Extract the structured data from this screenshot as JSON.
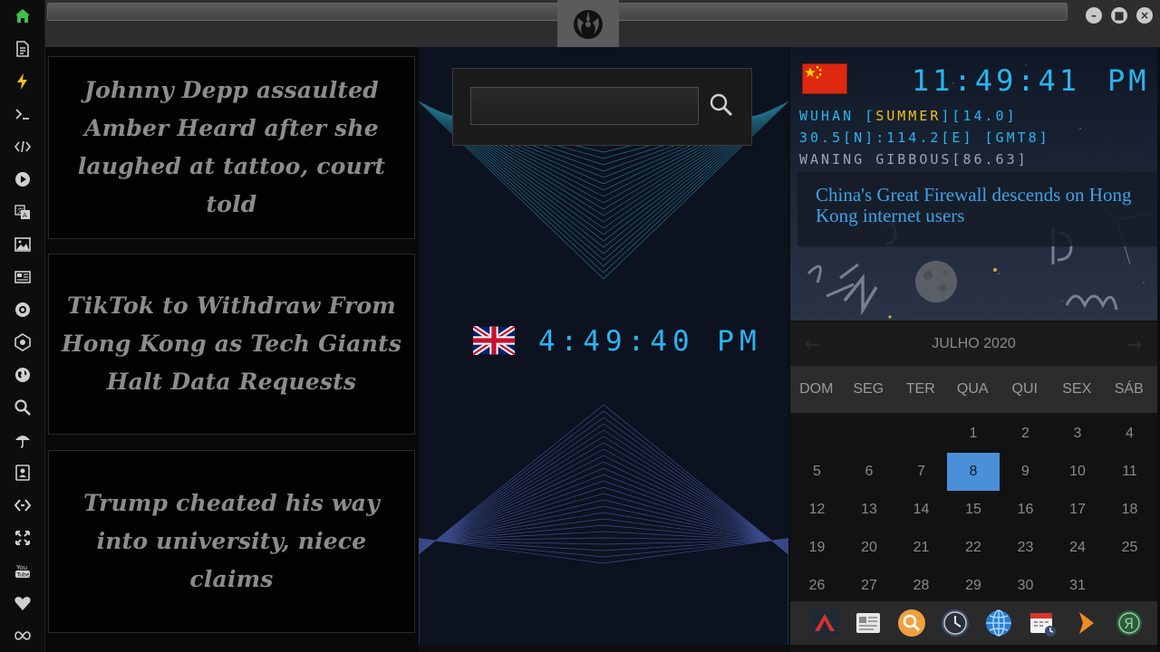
{
  "sidebar": {
    "items": [
      {
        "icon": "home-icon"
      },
      {
        "icon": "document-icon"
      },
      {
        "icon": "lightning-icon"
      },
      {
        "icon": "terminal-icon"
      },
      {
        "icon": "code-icon"
      },
      {
        "icon": "play-icon"
      },
      {
        "icon": "translate-icon"
      },
      {
        "icon": "image-icon"
      },
      {
        "icon": "newspaper-icon"
      },
      {
        "icon": "rebel-alliance-icon"
      },
      {
        "icon": "empire-icon"
      },
      {
        "icon": "globe-icon"
      },
      {
        "icon": "search-icon"
      },
      {
        "icon": "umbrella-icon"
      },
      {
        "icon": "contacts-icon"
      },
      {
        "icon": "dev-icon"
      },
      {
        "icon": "expand-icon"
      },
      {
        "icon": "youtube-icon"
      },
      {
        "icon": "heart-icon"
      },
      {
        "icon": "infinity-icon"
      }
    ],
    "active_color": "#3cc24a",
    "accent_color": "#f0c020",
    "youtube_label": "You Tube"
  },
  "titlebar": {
    "logo_icon": "rebel-alliance-logo",
    "buttons": {
      "minimize": "–",
      "maximize": "■",
      "close": "×"
    }
  },
  "news": {
    "articles": [
      {
        "headline": "Johnny Depp assaulted Amber Heard after she laughed at tattoo, court told"
      },
      {
        "headline": "TikTok to Withdraw From Hong Kong as Tech Giants Halt Data Requests"
      },
      {
        "headline": "Trump cheated his way into university, niece claims"
      }
    ]
  },
  "center": {
    "search": {
      "value": "",
      "placeholder": ""
    },
    "uk_clock": {
      "flag": "uk-flag",
      "time": "4:49:40 PM"
    }
  },
  "china_panel": {
    "flag": "china-flag",
    "time": "11:49:41",
    "ampm": "PM",
    "location_prefix": "WUHAN [",
    "season": "SUMMER",
    "location_suffix": "][14.0]",
    "coords": "30.5[N]:114.2[E] [GMT8]",
    "moon": "WANING GIBBOUS[86.63]",
    "headline": "China's Great Firewall descends on Hong Kong internet users"
  },
  "calendar": {
    "month_label": "JULHO 2020",
    "prev_label": "←",
    "next_label": "→",
    "weekdays": [
      "DOM",
      "SEG",
      "TER",
      "QUA",
      "QUI",
      "SEX",
      "SÁB"
    ],
    "first_weekday_index": 3,
    "days_in_month": 31,
    "today": 8,
    "highlight_color": "#4a90d9"
  },
  "dock": {
    "items": [
      {
        "icon": "red-triangle-app-icon"
      },
      {
        "icon": "newspaper-app-icon"
      },
      {
        "icon": "search-app-icon"
      },
      {
        "icon": "clock-app-icon"
      },
      {
        "icon": "globe-app-icon"
      },
      {
        "icon": "calendar-app-icon"
      },
      {
        "icon": "play-arrow-app-icon"
      },
      {
        "icon": "yandex-app-icon"
      }
    ]
  }
}
